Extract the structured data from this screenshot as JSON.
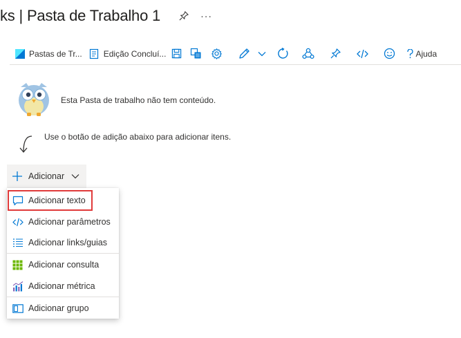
{
  "title": {
    "text": "ks | Pasta de Trabalho 1",
    "pin_icon": "pin-icon",
    "more_label": "···"
  },
  "toolbar": {
    "items": [
      {
        "icon": "workbook-icon",
        "label": "Pastas de Tr..."
      },
      {
        "icon": "edit-done-icon",
        "label": "Edição Concluí..."
      },
      {
        "icon": "save-icon"
      },
      {
        "icon": "clone-icon"
      },
      {
        "icon": "settings-icon"
      },
      {
        "icon": "pencil-icon"
      },
      {
        "icon": "chevron-down-icon"
      },
      {
        "icon": "refresh-icon"
      },
      {
        "icon": "share-icon"
      },
      {
        "icon": "pin-icon"
      },
      {
        "icon": "code-icon"
      },
      {
        "icon": "smiley-icon"
      },
      {
        "icon": "help-icon",
        "label": "Ajuda"
      }
    ]
  },
  "empty_state": {
    "message": "Esta Pasta de trabalho não tem conteúdo.",
    "hint": "Use o botão de adição abaixo para adicionar itens."
  },
  "add_button": {
    "label": "Adicionar"
  },
  "add_menu": {
    "items": [
      {
        "label": "Adicionar texto",
        "icon": "comment-icon"
      },
      {
        "label": "Adicionar parâmetros",
        "icon": "code-icon"
      },
      {
        "label": "Adicionar links/guias",
        "icon": "list-icon"
      },
      {
        "label": "Adicionar consulta",
        "icon": "grid-icon"
      },
      {
        "label": "Adicionar métrica",
        "icon": "metric-icon"
      },
      {
        "label": "Adicionar grupo",
        "icon": "group-icon"
      }
    ]
  },
  "colors": {
    "accent": "#0078d4",
    "highlight_border": "#e03a3a",
    "query_green": "#6bb700",
    "metric_purple": "#8764b8"
  }
}
